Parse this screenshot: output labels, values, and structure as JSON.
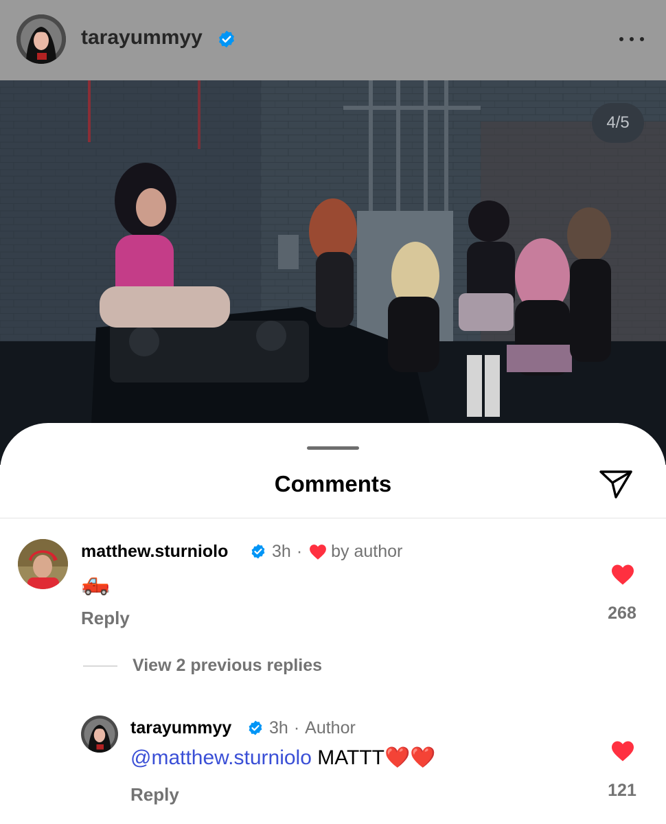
{
  "post": {
    "username": "tarayummyy",
    "counter": "4/5"
  },
  "sheet": {
    "title": "Comments"
  },
  "comments": [
    {
      "username": "matthew.sturniolo",
      "time": "3h",
      "separator": "·",
      "badge": "by author",
      "body": "🛻",
      "reply_label": "Reply",
      "like_count": "268"
    }
  ],
  "thread": {
    "view_replies_label": "View 2 previous replies"
  },
  "replies": [
    {
      "username": "tarayummyy",
      "time": "3h",
      "separator": "·",
      "badge": "Author",
      "mention": "@matthew.sturniolo",
      "body": "MATTT❤️❤️",
      "reply_label": "Reply",
      "like_count": "121"
    }
  ],
  "colors": {
    "like_red": "#ff3040",
    "verified_blue": "#0095f6",
    "mention_blue": "#3a4fd6"
  }
}
